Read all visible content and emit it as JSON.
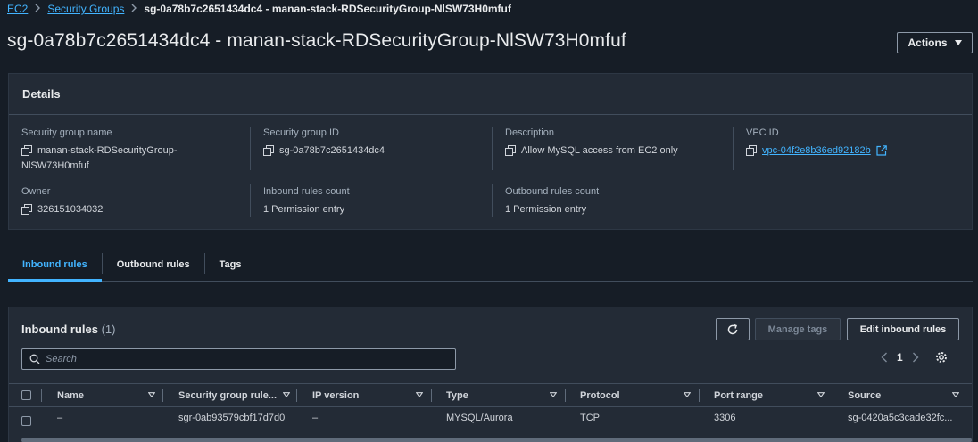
{
  "breadcrumb": {
    "items": [
      "EC2",
      "Security Groups"
    ],
    "current": "sg-0a78b7c2651434dc4 - manan-stack-RDSecurityGroup-NlSW73H0mfuf"
  },
  "page": {
    "title": "sg-0a78b7c2651434dc4 - manan-stack-RDSecurityGroup-NlSW73H0mfuf",
    "actions_label": "Actions"
  },
  "details": {
    "header": "Details",
    "sg_name_label": "Security group name",
    "sg_name_line1": "manan-stack-RDSecurityGroup-",
    "sg_name_line2": "NlSW73H0mfuf",
    "sg_id_label": "Security group ID",
    "sg_id_value": "sg-0a78b7c2651434dc4",
    "description_label": "Description",
    "description_value": "Allow MySQL access from EC2 only",
    "vpc_label": "VPC ID",
    "vpc_value": "vpc-04f2e8b36ed92182b",
    "owner_label": "Owner",
    "owner_value": "326151034032",
    "inbound_count_label": "Inbound rules count",
    "inbound_count_value": "1 Permission entry",
    "outbound_count_label": "Outbound rules count",
    "outbound_count_value": "1 Permission entry"
  },
  "tabs": [
    "Inbound rules",
    "Outbound rules",
    "Tags"
  ],
  "rules": {
    "title": "Inbound rules",
    "count": "(1)",
    "manage_tags_label": "Manage tags",
    "edit_label": "Edit inbound rules",
    "search_placeholder": "Search",
    "page_number": "1",
    "columns": [
      "Name",
      "Security group rule...",
      "IP version",
      "Type",
      "Protocol",
      "Port range",
      "Source"
    ],
    "rows": [
      {
        "name": "–",
        "rule_id": "sgr-0ab93579cbf17d7d0",
        "ip_version": "–",
        "type": "MYSQL/Aurora",
        "protocol": "TCP",
        "port_range": "3306",
        "source": "sg-0420a5c3cade32fc..."
      }
    ]
  },
  "colors": {
    "background": "#161d26",
    "panel": "#232b36",
    "link": "#42b4ff",
    "border": "#414d5c"
  }
}
